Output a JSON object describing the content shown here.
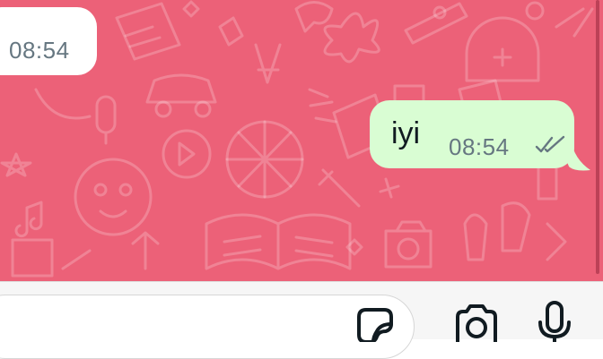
{
  "theme": {
    "wallpaper_color": "#ec6178",
    "incoming_bubble_color": "#ffffff",
    "outgoing_bubble_color": "#d9fdd3",
    "tick_color": "#667781",
    "icon_color": "#111b21"
  },
  "messages": [
    {
      "direction": "incoming",
      "time": "08:54"
    },
    {
      "direction": "outgoing",
      "text": "iyi",
      "time": "08:54",
      "status": "read-double-check"
    }
  ],
  "composer": {
    "placeholder": "",
    "icons": [
      "sticker-icon",
      "camera-icon",
      "microphone-icon"
    ]
  }
}
